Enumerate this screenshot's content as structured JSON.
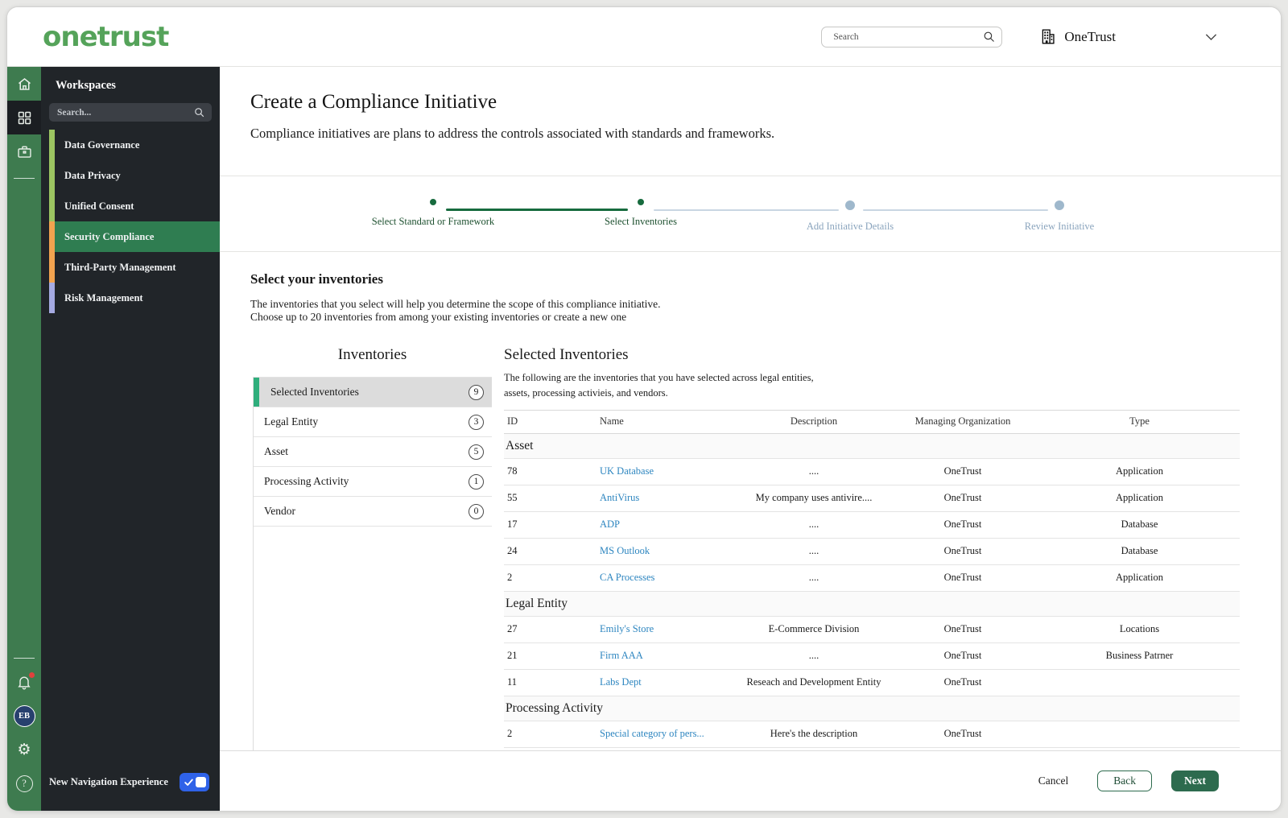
{
  "header": {
    "logo_text": "onetrust",
    "search_placeholder": "Search",
    "org_name": "OneTrust"
  },
  "icons": {
    "gear_glyph": "⚙",
    "help_glyph": "?"
  },
  "sidebar": {
    "title": "Workspaces",
    "search_placeholder": "Search...",
    "items": [
      {
        "label": "Data Governance",
        "strip": "#9cc561",
        "active": false
      },
      {
        "label": "Data Privacy",
        "strip": "#9cc561",
        "active": false
      },
      {
        "label": "Unified Consent",
        "strip": "#9cc561",
        "active": false
      },
      {
        "label": "Security Compliance",
        "strip": "#f2a34f",
        "active": true
      },
      {
        "label": "Third-Party Management",
        "strip": "#f2a34f",
        "active": false
      },
      {
        "label": "Risk Management",
        "strip": "#a5aae2",
        "active": false
      }
    ],
    "avatar_initials": "EB",
    "toggle_label": "New Navigation Experience",
    "toggle_state": "on"
  },
  "wizard": {
    "title": "Create a Compliance Initiative",
    "subtitle": "Compliance initiatives are plans to address the controls associated with standards and frameworks.",
    "steps": [
      {
        "label": "Select Standard or Framework",
        "state": "complete",
        "reached": true
      },
      {
        "label": "Select Inventories",
        "state": "current",
        "reached": true
      },
      {
        "label": "Add Initiative Details",
        "state": "upcoming",
        "reached": false
      },
      {
        "label": "Review Initiative",
        "state": "upcoming",
        "reached": false
      }
    ]
  },
  "section": {
    "title": "Select your inventories",
    "description_line1": "The inventories that you select will help you determine the scope of this compliance initiative.",
    "description_line2": "Choose up to 20 inventories from among your existing inventories or create a new one"
  },
  "inventories_panel": {
    "title": "Inventories",
    "items": [
      {
        "label": "Selected Inventories",
        "count": "9",
        "active": true
      },
      {
        "label": "Legal Entity",
        "count": "3",
        "active": false
      },
      {
        "label": "Asset",
        "count": "5",
        "active": false
      },
      {
        "label": "Processing Activity",
        "count": "1",
        "active": false
      },
      {
        "label": "Vendor",
        "count": "0",
        "active": false
      }
    ]
  },
  "selected_panel": {
    "title": "Selected Inventories",
    "description_line1": "The following are the inventories that you have selected across legal entities,",
    "description_line2": "assets, processing activieis, and vendors.",
    "columns": [
      "ID",
      "Name",
      "Description",
      "Managing Organization",
      "Type"
    ],
    "groups": [
      {
        "name": "Asset",
        "rows": [
          {
            "id": "78",
            "name": "UK Database",
            "description": "....",
            "org": "OneTrust",
            "type": "Application"
          },
          {
            "id": "55",
            "name": "AntiVirus",
            "description": "My company uses antivire....",
            "org": "OneTrust",
            "type": "Application"
          },
          {
            "id": "17",
            "name": "ADP",
            "description": "....",
            "org": "OneTrust",
            "type": "Database"
          },
          {
            "id": "24",
            "name": "MS Outlook",
            "description": "....",
            "org": "OneTrust",
            "type": "Database"
          },
          {
            "id": "2",
            "name": "CA Processes",
            "description": "....",
            "org": "OneTrust",
            "type": "Application"
          }
        ]
      },
      {
        "name": "Legal Entity",
        "rows": [
          {
            "id": "27",
            "name": "Emily's Store",
            "description": "E-Commerce Division",
            "org": "OneTrust",
            "type": "Locations"
          },
          {
            "id": "21",
            "name": "Firm AAA",
            "description": "....",
            "org": "OneTrust",
            "type": "Business Patrner"
          },
          {
            "id": "11",
            "name": "Labs Dept",
            "description": "Reseach and Development Entity",
            "org": "OneTrust",
            "type": ""
          }
        ]
      },
      {
        "name": "Processing Activity",
        "rows": [
          {
            "id": "2",
            "name": "Special category of pers...",
            "description": "Here's the description",
            "org": "OneTrust",
            "type": ""
          }
        ]
      }
    ]
  },
  "footer": {
    "cancel_label": "Cancel",
    "back_label": "Back",
    "next_label": "Next"
  },
  "colors": {
    "brand_green": "#55a35a",
    "rail_green": "#3e7b4f",
    "sidebar_dark": "#212529",
    "active_workspace_green": "#2f7d51",
    "stepper_green": "#176b3e",
    "stepper_inactive": "#9fb8cc",
    "link_blue": "#2e86c0",
    "toggle_blue": "#2f62e8",
    "selected_strip_teal": "#2fae7c",
    "next_button_green": "#2d6b4e"
  }
}
